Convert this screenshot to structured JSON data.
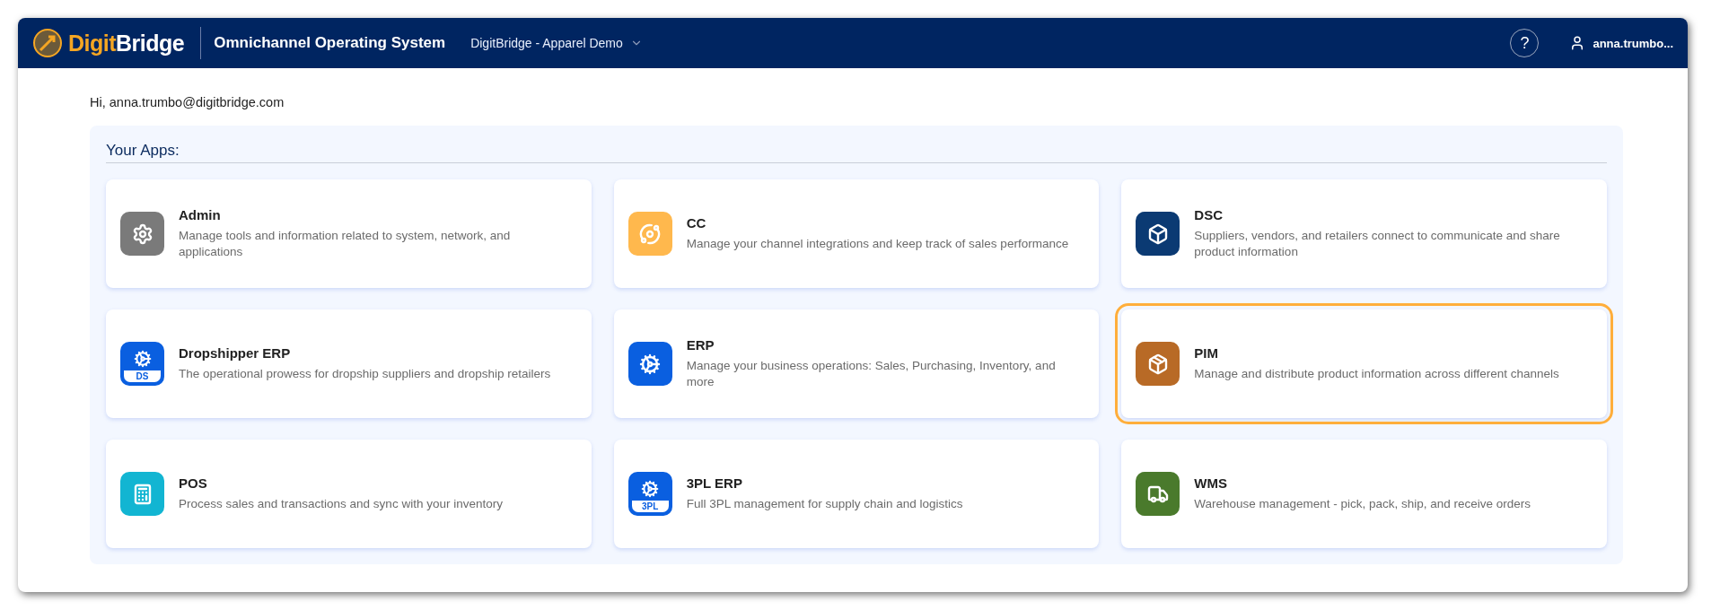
{
  "header": {
    "logo": {
      "part_1": "Digit",
      "part_2": "Bridge"
    },
    "title": "Omnichannel Operating System",
    "workspace": "DigitBridge - Apparel Demo",
    "help": "?",
    "user": "anna.trumbo..."
  },
  "greeting": "Hi, anna.trumbo@digitbridge.com",
  "apps_section": {
    "heading": "Your Apps:",
    "apps": [
      {
        "name": "Admin",
        "description": "Manage tools and information related to system, network, and applications",
        "kind": "admin",
        "color": "#7a7a7a",
        "selected": false
      },
      {
        "name": "CC",
        "description": "Manage your channel integrations and keep track of sales performance",
        "kind": "cc",
        "color": "#ffb84d",
        "selected": false
      },
      {
        "name": "DSC",
        "description": "Suppliers, vendors, and retailers connect to communicate and share product information",
        "kind": "dsc",
        "color": "#0b3a73",
        "selected": false
      },
      {
        "name": "Dropshipper ERP",
        "description": "The operational prowess for dropship suppliers and dropship retailers",
        "kind": "erp",
        "color": "#0a5fe0",
        "badge": "DS",
        "selected": false
      },
      {
        "name": "ERP",
        "description": "Manage your business operations: Sales, Purchasing, Inventory, and more",
        "kind": "erp",
        "color": "#0a5fe0",
        "selected": false
      },
      {
        "name": "PIM",
        "description": "Manage and distribute product information across different channels",
        "kind": "pim",
        "color": "#b86a26",
        "selected": true
      },
      {
        "name": "POS",
        "description": "Process sales and transactions and sync with your inventory",
        "kind": "pos",
        "color": "#12b5d2",
        "selected": false
      },
      {
        "name": "3PL ERP",
        "description": "Full 3PL management for supply chain and logistics",
        "kind": "erp",
        "color": "#0a5fe0",
        "badge": "3PL",
        "selected": false
      },
      {
        "name": "WMS",
        "description": "Warehouse management - pick, pack, ship, and receive orders",
        "kind": "wms",
        "color": "#4a7a2c",
        "selected": false
      }
    ]
  }
}
